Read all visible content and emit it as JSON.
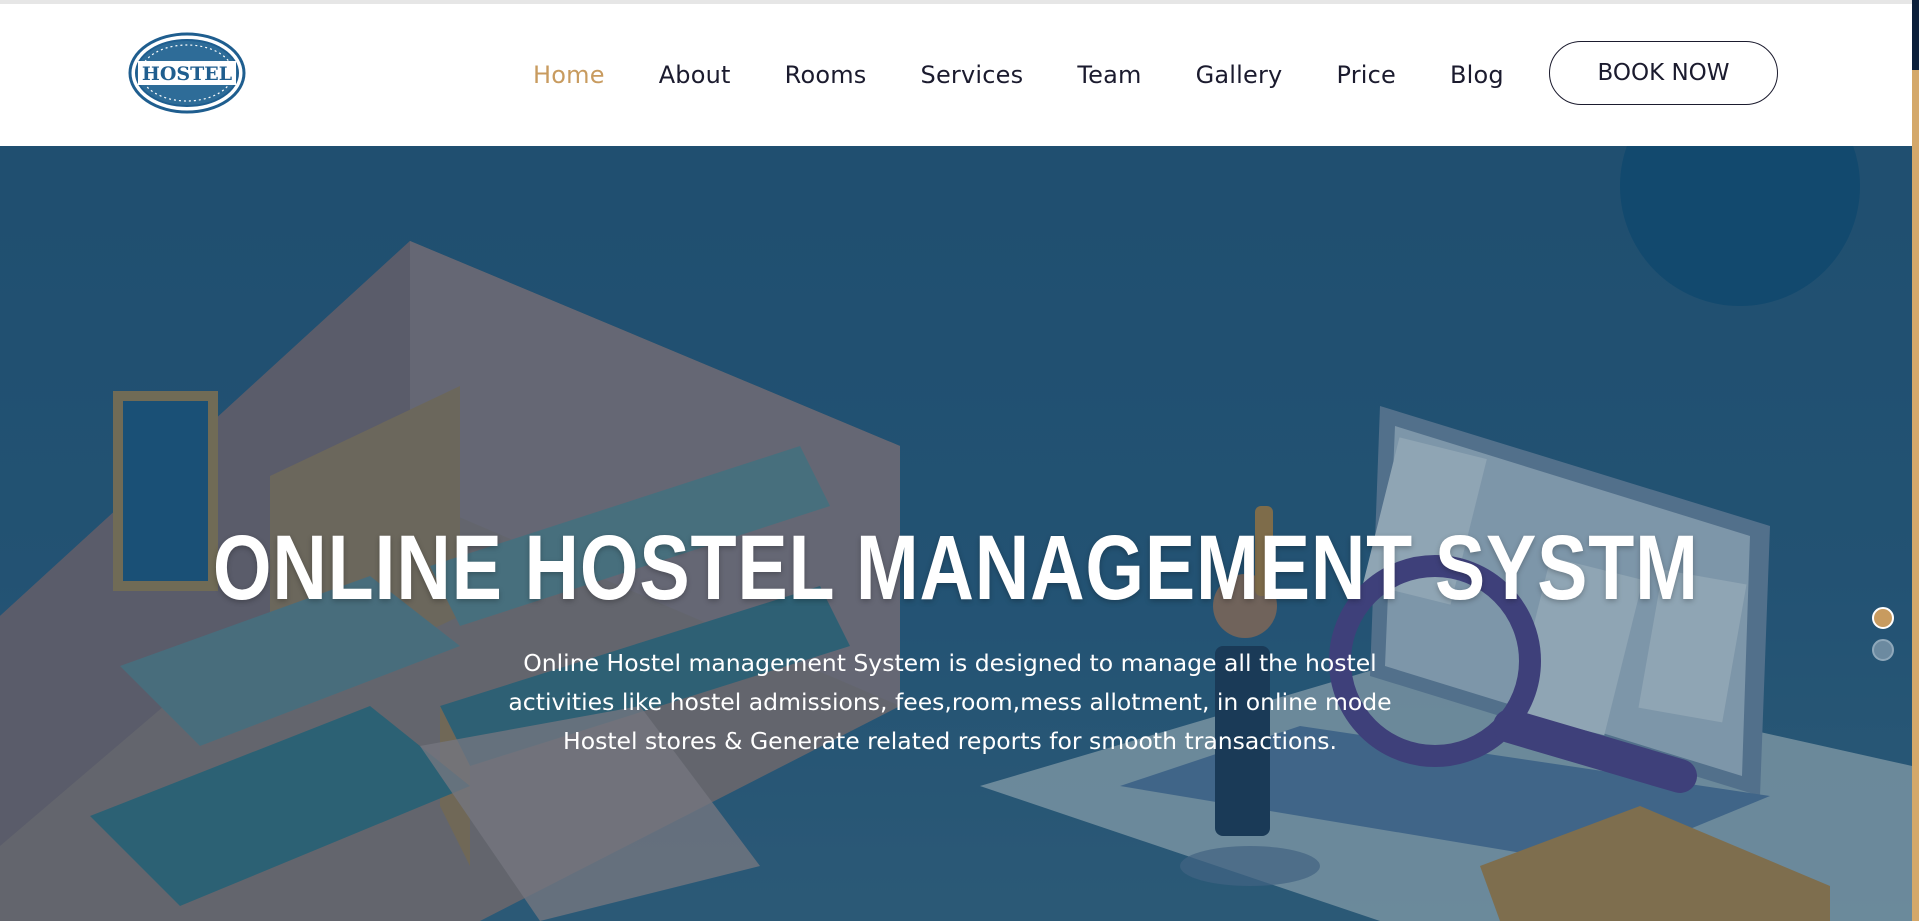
{
  "brand": {
    "logo_text": "HOSTEL",
    "logo_color": "#1f5e8f"
  },
  "nav": {
    "items": [
      {
        "label": "Home",
        "active": true
      },
      {
        "label": "About"
      },
      {
        "label": "Rooms"
      },
      {
        "label": "Services"
      },
      {
        "label": "Team"
      },
      {
        "label": "Gallery"
      },
      {
        "label": "Price"
      },
      {
        "label": "Blog"
      }
    ],
    "book_label": "BOOK NOW",
    "active_color": "#c89b5f"
  },
  "hero": {
    "title": "ONLINE HOSTEL MANAGEMENT SYSTM",
    "description_lines": [
      "Online Hostel management System is designed to manage all the hostel",
      "activities like hostel admissions, fees,room,mess allotment, in online mode",
      "Hostel stores & Generate related reports for smooth transactions."
    ],
    "slider": {
      "total": 2,
      "active": 1
    }
  },
  "colors": {
    "accent": "#c89b5f",
    "hero_blue": "#2b5e80",
    "text_dark": "#1b1b2e"
  }
}
